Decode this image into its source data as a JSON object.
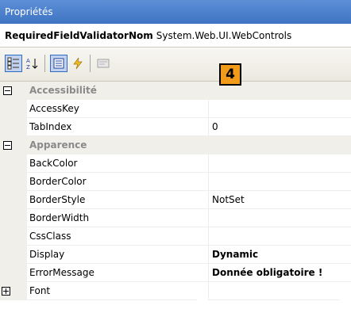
{
  "window": {
    "title": "Propriétés"
  },
  "object": {
    "name": "RequiredFieldValidatorNom",
    "type": "System.Web.UI.WebControls"
  },
  "toolbar": {
    "buttons": [
      {
        "name": "categorized-view-icon"
      },
      {
        "name": "alphabetical-sort-icon",
        "glyph": "A↓"
      },
      {
        "name": "properties-view-icon"
      },
      {
        "name": "events-view-icon"
      },
      {
        "name": "property-pages-icon"
      }
    ]
  },
  "badge": {
    "label": "4"
  },
  "grid": {
    "categories": [
      {
        "label": "Accessibilité",
        "expanded": true,
        "properties": [
          {
            "name": "AccessKey",
            "value": ""
          },
          {
            "name": "TabIndex",
            "value": "0"
          }
        ]
      },
      {
        "label": "Apparence",
        "expanded": true,
        "properties": [
          {
            "name": "BackColor",
            "value": ""
          },
          {
            "name": "BorderColor",
            "value": ""
          },
          {
            "name": "BorderStyle",
            "value": "NotSet"
          },
          {
            "name": "BorderWidth",
            "value": ""
          },
          {
            "name": "CssClass",
            "value": ""
          },
          {
            "name": "Display",
            "value": "Dynamic",
            "bold": true
          },
          {
            "name": "ErrorMessage",
            "value": "Donnée obligatoire !",
            "bold": true
          },
          {
            "name": "Font",
            "value": "",
            "expandable": true
          }
        ]
      }
    ]
  },
  "colors": {
    "title_bar": "#3f74c4",
    "badge": "#f29a1a",
    "category_text": "#8a8a8a"
  }
}
